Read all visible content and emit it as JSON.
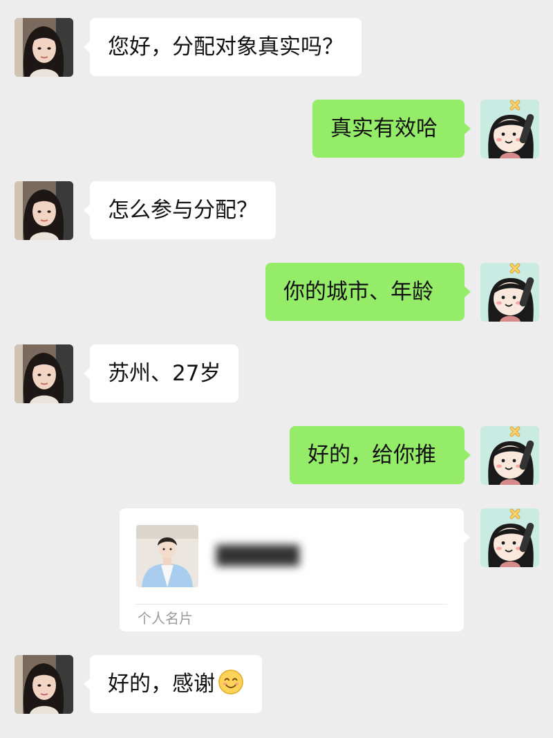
{
  "messages": [
    {
      "side": "left",
      "text": "您好，分配对象真实吗？"
    },
    {
      "side": "right",
      "text": "真实有效哈"
    },
    {
      "side": "left",
      "text": "怎么参与分配？"
    },
    {
      "side": "right",
      "text": "你的城市、年龄"
    },
    {
      "side": "left",
      "text": "苏州、27岁"
    },
    {
      "side": "right",
      "text": "好的，给你推"
    },
    {
      "side": "left",
      "text": "好的，感谢",
      "emoji": "smiling-face-emoji"
    }
  ],
  "contact_card": {
    "name": "██████",
    "label": "个人名片"
  },
  "colors": {
    "background": "#ededed",
    "sent_bubble": "#95ec69",
    "received_bubble": "#ffffff"
  }
}
